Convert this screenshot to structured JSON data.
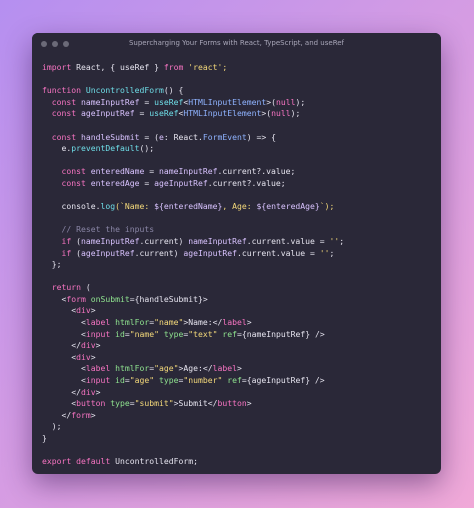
{
  "window": {
    "title": "Supercharging Your Forms with React, TypeScript, and useRef"
  },
  "code": {
    "lines": [
      [
        {
          "t": "import",
          "c": "kw"
        },
        {
          "t": " React, { useRef } ",
          "c": "pn"
        },
        {
          "t": "from",
          "c": "kw"
        },
        {
          "t": " 'react';",
          "c": "str"
        }
      ],
      [],
      [
        {
          "t": "function",
          "c": "kw"
        },
        {
          "t": " UncontrolledForm",
          "c": "fn"
        },
        {
          "t": "() {",
          "c": "pn"
        }
      ],
      [
        {
          "t": "  const",
          "c": "kw"
        },
        {
          "t": " nameInputRef",
          "c": "var"
        },
        {
          "t": " = ",
          "c": "pn"
        },
        {
          "t": "useRef",
          "c": "fn"
        },
        {
          "t": "<",
          "c": "pn"
        },
        {
          "t": "HTMLInputElement",
          "c": "typ"
        },
        {
          "t": ">(",
          "c": "pn"
        },
        {
          "t": "null",
          "c": "kw"
        },
        {
          "t": ");",
          "c": "pn"
        }
      ],
      [
        {
          "t": "  const",
          "c": "kw"
        },
        {
          "t": " ageInputRef",
          "c": "var"
        },
        {
          "t": " = ",
          "c": "pn"
        },
        {
          "t": "useRef",
          "c": "fn"
        },
        {
          "t": "<",
          "c": "pn"
        },
        {
          "t": "HTMLInputElement",
          "c": "typ"
        },
        {
          "t": ">(",
          "c": "pn"
        },
        {
          "t": "null",
          "c": "kw"
        },
        {
          "t": ");",
          "c": "pn"
        }
      ],
      [],
      [
        {
          "t": "  const",
          "c": "kw"
        },
        {
          "t": " handleSubmit",
          "c": "var"
        },
        {
          "t": " = (",
          "c": "pn"
        },
        {
          "t": "e",
          "c": "var"
        },
        {
          "t": ": React.",
          "c": "pn"
        },
        {
          "t": "FormEvent",
          "c": "typ"
        },
        {
          "t": ") => {",
          "c": "pn"
        }
      ],
      [
        {
          "t": "    e.",
          "c": "pn"
        },
        {
          "t": "preventDefault",
          "c": "fn"
        },
        {
          "t": "();",
          "c": "pn"
        }
      ],
      [],
      [
        {
          "t": "    const",
          "c": "kw"
        },
        {
          "t": " enteredName",
          "c": "var"
        },
        {
          "t": " = ",
          "c": "pn"
        },
        {
          "t": "nameInputRef",
          "c": "var"
        },
        {
          "t": ".current?.value;",
          "c": "pn"
        }
      ],
      [
        {
          "t": "    const",
          "c": "kw"
        },
        {
          "t": " enteredAge",
          "c": "var"
        },
        {
          "t": " = ",
          "c": "pn"
        },
        {
          "t": "ageInputRef",
          "c": "var"
        },
        {
          "t": ".current?.value;",
          "c": "pn"
        }
      ],
      [],
      [
        {
          "t": "    console.",
          "c": "pn"
        },
        {
          "t": "log",
          "c": "fn"
        },
        {
          "t": "(`Name: ",
          "c": "str"
        },
        {
          "t": "${enteredName}",
          "c": "var"
        },
        {
          "t": ", Age: ",
          "c": "str"
        },
        {
          "t": "${enteredAge}",
          "c": "var"
        },
        {
          "t": "`);",
          "c": "str"
        }
      ],
      [],
      [
        {
          "t": "    // Reset the inputs",
          "c": "cmt"
        }
      ],
      [
        {
          "t": "    if",
          "c": "kw"
        },
        {
          "t": " (",
          "c": "pn"
        },
        {
          "t": "nameInputRef",
          "c": "var"
        },
        {
          "t": ".current) ",
          "c": "pn"
        },
        {
          "t": "nameInputRef",
          "c": "var"
        },
        {
          "t": ".current.value = ",
          "c": "pn"
        },
        {
          "t": "''",
          "c": "str"
        },
        {
          "t": ";",
          "c": "pn"
        }
      ],
      [
        {
          "t": "    if",
          "c": "kw"
        },
        {
          "t": " (",
          "c": "pn"
        },
        {
          "t": "ageInputRef",
          "c": "var"
        },
        {
          "t": ".current) ",
          "c": "pn"
        },
        {
          "t": "ageInputRef",
          "c": "var"
        },
        {
          "t": ".current.value = ",
          "c": "pn"
        },
        {
          "t": "''",
          "c": "str"
        },
        {
          "t": ";",
          "c": "pn"
        }
      ],
      [
        {
          "t": "  };",
          "c": "pn"
        }
      ],
      [],
      [
        {
          "t": "  return",
          "c": "kw"
        },
        {
          "t": " (",
          "c": "pn"
        }
      ],
      [
        {
          "t": "    <",
          "c": "pn"
        },
        {
          "t": "form",
          "c": "tag"
        },
        {
          "t": " onSubmit",
          "c": "attr"
        },
        {
          "t": "={handleSubmit}>",
          "c": "pn"
        }
      ],
      [
        {
          "t": "      <",
          "c": "pn"
        },
        {
          "t": "div",
          "c": "tag"
        },
        {
          "t": ">",
          "c": "pn"
        }
      ],
      [
        {
          "t": "        <",
          "c": "pn"
        },
        {
          "t": "label",
          "c": "tag"
        },
        {
          "t": " htmlFor",
          "c": "attr"
        },
        {
          "t": "=",
          "c": "pn"
        },
        {
          "t": "\"name\"",
          "c": "str"
        },
        {
          "t": ">Name:</",
          "c": "pn"
        },
        {
          "t": "label",
          "c": "tag"
        },
        {
          "t": ">",
          "c": "pn"
        }
      ],
      [
        {
          "t": "        <",
          "c": "pn"
        },
        {
          "t": "input",
          "c": "tag"
        },
        {
          "t": " id",
          "c": "attr"
        },
        {
          "t": "=",
          "c": "pn"
        },
        {
          "t": "\"name\"",
          "c": "str"
        },
        {
          "t": " type",
          "c": "attr"
        },
        {
          "t": "=",
          "c": "pn"
        },
        {
          "t": "\"text\"",
          "c": "str"
        },
        {
          "t": " ref",
          "c": "attr"
        },
        {
          "t": "={nameInputRef} />",
          "c": "pn"
        }
      ],
      [
        {
          "t": "      </",
          "c": "pn"
        },
        {
          "t": "div",
          "c": "tag"
        },
        {
          "t": ">",
          "c": "pn"
        }
      ],
      [
        {
          "t": "      <",
          "c": "pn"
        },
        {
          "t": "div",
          "c": "tag"
        },
        {
          "t": ">",
          "c": "pn"
        }
      ],
      [
        {
          "t": "        <",
          "c": "pn"
        },
        {
          "t": "label",
          "c": "tag"
        },
        {
          "t": " htmlFor",
          "c": "attr"
        },
        {
          "t": "=",
          "c": "pn"
        },
        {
          "t": "\"age\"",
          "c": "str"
        },
        {
          "t": ">Age:</",
          "c": "pn"
        },
        {
          "t": "label",
          "c": "tag"
        },
        {
          "t": ">",
          "c": "pn"
        }
      ],
      [
        {
          "t": "        <",
          "c": "pn"
        },
        {
          "t": "input",
          "c": "tag"
        },
        {
          "t": " id",
          "c": "attr"
        },
        {
          "t": "=",
          "c": "pn"
        },
        {
          "t": "\"age\"",
          "c": "str"
        },
        {
          "t": " type",
          "c": "attr"
        },
        {
          "t": "=",
          "c": "pn"
        },
        {
          "t": "\"number\"",
          "c": "str"
        },
        {
          "t": " ref",
          "c": "attr"
        },
        {
          "t": "={ageInputRef} />",
          "c": "pn"
        }
      ],
      [
        {
          "t": "      </",
          "c": "pn"
        },
        {
          "t": "div",
          "c": "tag"
        },
        {
          "t": ">",
          "c": "pn"
        }
      ],
      [
        {
          "t": "      <",
          "c": "pn"
        },
        {
          "t": "button",
          "c": "tag"
        },
        {
          "t": " type",
          "c": "attr"
        },
        {
          "t": "=",
          "c": "pn"
        },
        {
          "t": "\"submit\"",
          "c": "str"
        },
        {
          "t": ">Submit</",
          "c": "pn"
        },
        {
          "t": "button",
          "c": "tag"
        },
        {
          "t": ">",
          "c": "pn"
        }
      ],
      [
        {
          "t": "    </",
          "c": "pn"
        },
        {
          "t": "form",
          "c": "tag"
        },
        {
          "t": ">",
          "c": "pn"
        }
      ],
      [
        {
          "t": "  );",
          "c": "pn"
        }
      ],
      [
        {
          "t": "}",
          "c": "pn"
        }
      ],
      [],
      [
        {
          "t": "export",
          "c": "kw"
        },
        {
          "t": " default",
          "c": "kw"
        },
        {
          "t": " UncontrolledForm;",
          "c": "pn"
        }
      ]
    ]
  }
}
